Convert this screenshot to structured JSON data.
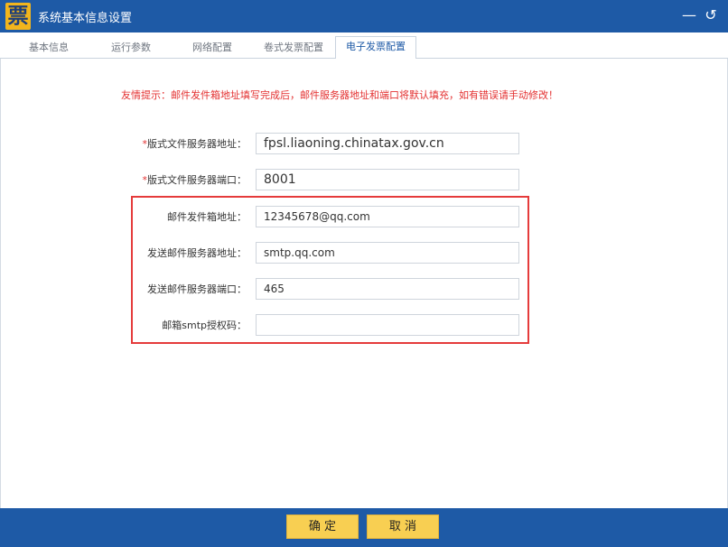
{
  "window": {
    "title": "系统基本信息设置",
    "logo_text": "票",
    "minimize_icon": "—",
    "back_icon": "↺"
  },
  "tabs": [
    {
      "label": "基本信息"
    },
    {
      "label": "运行参数"
    },
    {
      "label": "网络配置"
    },
    {
      "label": "卷式发票配置"
    },
    {
      "label": "电子发票配置",
      "active": true
    }
  ],
  "notice": "友情提示：邮件发件箱地址填写完成后，邮件服务器地址和端口将默认填充，如有错误请手动修改！",
  "required_mark": "*",
  "fields": [
    {
      "label": "版式文件服务器地址：",
      "required": true,
      "value": "fpsl.liaoning.chinatax.gov.cn"
    },
    {
      "label": "版式文件服务器端口：",
      "required": true,
      "value": "8001"
    },
    {
      "label": "邮件发件箱地址：",
      "required": false,
      "value": "12345678@qq.com"
    },
    {
      "label": "发送邮件服务器地址：",
      "required": false,
      "value": "smtp.qq.com"
    },
    {
      "label": "发送邮件服务器端口：",
      "required": false,
      "value": "465"
    },
    {
      "label": "邮箱smtp授权码：",
      "required": false,
      "value": ""
    }
  ],
  "buttons": {
    "ok": "确 定",
    "cancel": "取 消"
  },
  "colors": {
    "titlebar": "#1e5aa6",
    "accent_yellow": "#f8cf52",
    "warning_red": "#e33030",
    "highlight_border": "#e53b3b"
  }
}
